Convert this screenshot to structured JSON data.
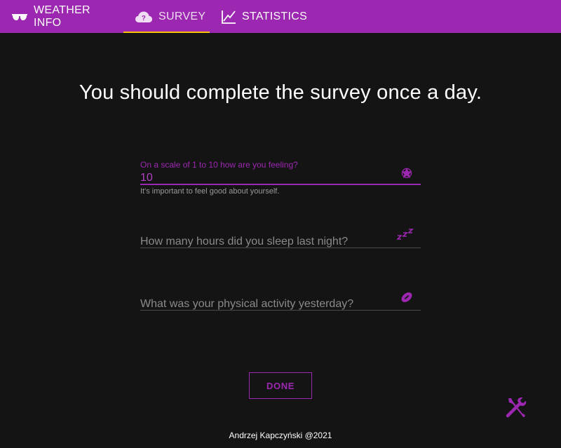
{
  "nav": {
    "tabs": [
      {
        "label": "WEATHER INFO",
        "icon": "sunglasses-icon"
      },
      {
        "label": "SURVEY",
        "icon": "cloud-question-icon",
        "active": true
      },
      {
        "label": "STATISTICS",
        "icon": "line-chart-icon"
      }
    ]
  },
  "survey": {
    "title": "You should complete the survey once a day.",
    "fields": [
      {
        "label": "On a scale of 1 to 10 how are you feeling?",
        "value": "10",
        "hint": "It's important to feel good about yourself.",
        "icon": "star-icon"
      },
      {
        "placeholder": "How many hours did you sleep last night?",
        "icon": "sleep-zzz-icon"
      },
      {
        "placeholder": "What was your physical activity yesterday?",
        "icon": "football-icon"
      }
    ],
    "done_label": "DONE"
  },
  "settings": {
    "icon": "tools-icon"
  },
  "footer": {
    "text": "Andrzej Kapczyński @2021"
  },
  "colors": {
    "primary": "#9c27b0",
    "accent": "#ffc107",
    "background": "#141414"
  }
}
